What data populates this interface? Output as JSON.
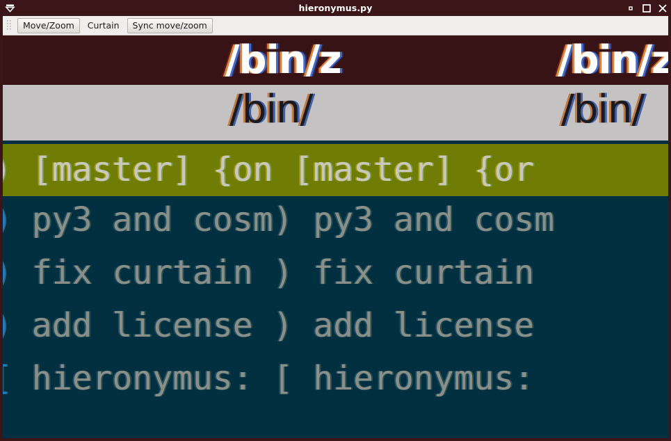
{
  "window": {
    "title": "hieronymus.py",
    "icon": "funnel-icon",
    "controls": {
      "minimize": "minimize-icon",
      "maximize": "maximize-icon",
      "close": "close-icon"
    },
    "colors": {
      "titlebar_bg": "#3b1517",
      "toolbar_bg": "#f0eeec",
      "band_dark": "#381316",
      "band_light": "#c4c2c2",
      "band_olive": "#6f7d07",
      "terminal_bg": "#023040",
      "terminal_fg": "#8a9089",
      "accent_cyan": "#1c7fc4"
    }
  },
  "toolbar": {
    "grip": "drag-handle",
    "move_zoom_label": "Move/Zoom",
    "curtain_label": "Curtain",
    "sync_label": "Sync move/zoom"
  },
  "magnified_content": {
    "bands": [
      {
        "id": "path-dark",
        "text_left": "/bin/z",
        "text_right": "/bin/z",
        "bg": "#381316",
        "fg": "#fdfdfd"
      },
      {
        "id": "path-light",
        "text_left": "/bin/",
        "text_right": "/bin/",
        "bg": "#c4c2c2",
        "fg": "#1a1a22"
      },
      {
        "id": "branch",
        "text": ") [master] {on [master] {or",
        "bg": "#6f7d07",
        "fg": "#c9c8bd"
      }
    ],
    "terminal_rows": [
      {
        "bracket": ")",
        "text": " py3 and cosm) py3 and cosm"
      },
      {
        "bracket": ")",
        "text": " fix curtain ) fix curtain"
      },
      {
        "bracket": ")",
        "text": " add license ) add license"
      },
      {
        "bracket": "[",
        "text": " hieronymus: [ hieronymus:"
      }
    ]
  }
}
